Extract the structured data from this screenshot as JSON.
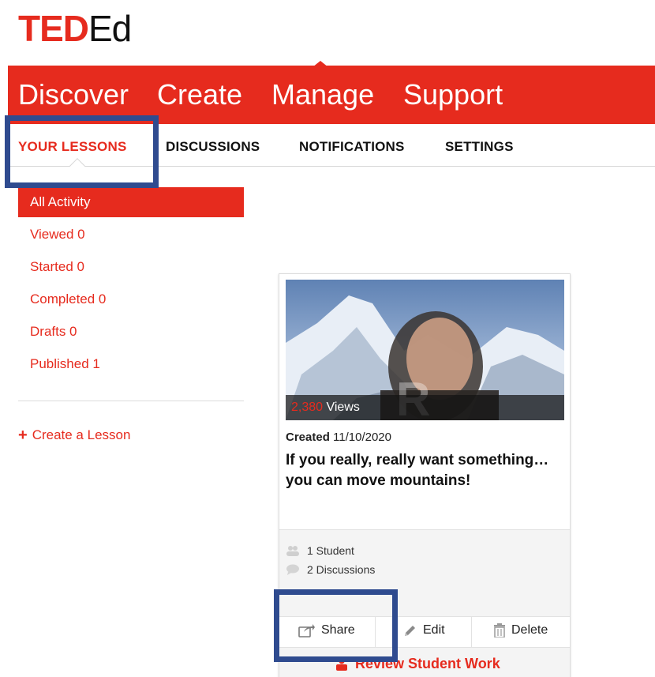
{
  "brand": {
    "ted": "TED",
    "ed": "Ed",
    "accent": "#e62b1e",
    "annotation_color": "#2f4b8f"
  },
  "main_nav": [
    "Discover",
    "Create",
    "Manage",
    "Support"
  ],
  "sub_nav": [
    "YOUR LESSONS",
    "DISCUSSIONS",
    "NOTIFICATIONS",
    "SETTINGS"
  ],
  "sub_nav_active": "YOUR LESSONS",
  "sidebar": {
    "items": [
      "All Activity",
      "Viewed 0",
      "Started 0",
      "Completed 0",
      "Drafts 0",
      "Published 1"
    ],
    "active": "All Activity",
    "create_lesson": "Create a Lesson"
  },
  "lesson_card": {
    "views_count": "2,380",
    "views_label": " Views",
    "created_label": "Created",
    "created_date": " 11/10/2020",
    "title": "If you really, really want something… you can move mountains!",
    "students": "1 Student",
    "discussions": "2 Discussions",
    "actions": {
      "share": "Share",
      "edit": "Edit",
      "delete": "Delete"
    },
    "review": "Review Student Work"
  }
}
